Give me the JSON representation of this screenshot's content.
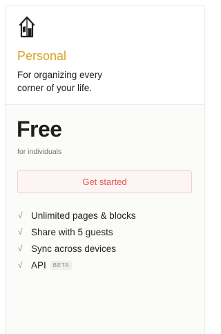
{
  "plan": {
    "name": "Personal",
    "description": "For organizing every corner of your life.",
    "price": "Free",
    "price_subtitle": "for individuals",
    "cta_label": "Get started",
    "accent_color": "#d9a225",
    "cta_color": "#e2574c"
  },
  "features": [
    {
      "check": "√",
      "label": "Unlimited pages & blocks"
    },
    {
      "check": "√",
      "label": "Share with 5 guests"
    },
    {
      "check": "√",
      "label": "Sync across devices"
    },
    {
      "check": "√",
      "label": "API",
      "badge": "BETA"
    }
  ],
  "icons": {
    "plan": "house-icon",
    "feature": "checkmark-icon"
  }
}
